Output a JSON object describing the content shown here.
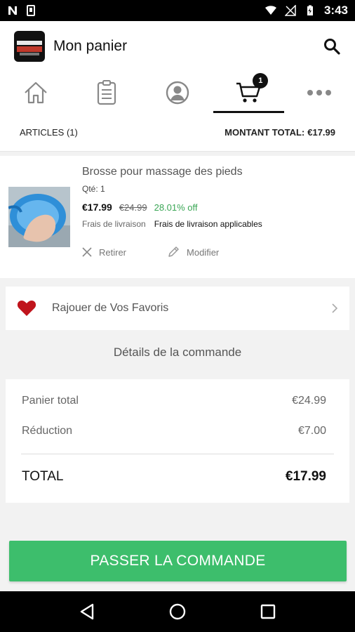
{
  "status_bar": {
    "time": "3:43"
  },
  "header": {
    "title": "Mon panier"
  },
  "tabs": [
    {
      "name": "home"
    },
    {
      "name": "orders"
    },
    {
      "name": "account"
    },
    {
      "name": "cart",
      "badge": "1"
    },
    {
      "name": "more"
    }
  ],
  "summary": {
    "articles_label": "ARTICLES (1)",
    "total_label": "MONTANT TOTAL:",
    "total_value": "€17.99"
  },
  "product": {
    "name": "Brosse pour massage des pieds",
    "quantity": "Qté: 1",
    "price_now": "€17.99",
    "price_old": "€24.99",
    "discount": "28.01% off",
    "shipping_label": "Frais de livraison",
    "shipping_value": "Frais de livraison applicables",
    "remove_label": "Retirer",
    "edit_label": "Modifier"
  },
  "favorites": {
    "label": "Rajouer de Vos Favoris"
  },
  "order_details": {
    "title": "Détails de la commande",
    "cart_total_label": "Panier total",
    "cart_total_value": "€24.99",
    "discount_label": "Réduction",
    "discount_value": "€7.00",
    "total_label": "TOTAL",
    "total_value": "€17.99"
  },
  "cta": {
    "label": "PASSER LA COMMANDE"
  },
  "colors": {
    "accent": "#3dbe6c",
    "discount_green": "#3aa655",
    "heart_red": "#c0141c"
  }
}
